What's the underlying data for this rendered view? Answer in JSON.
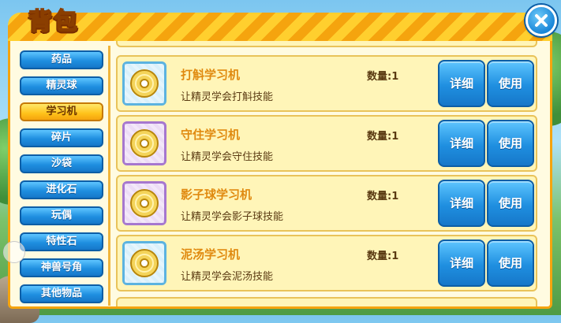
{
  "window": {
    "title": "背包",
    "close_icon": "close-icon",
    "accent_color": "#f5a40e",
    "button_color": "#1f8fe0"
  },
  "sidebar": {
    "tabs": [
      {
        "label": "药品",
        "active": false
      },
      {
        "label": "精灵球",
        "active": false
      },
      {
        "label": "学习机",
        "active": true
      },
      {
        "label": "碎片",
        "active": false
      },
      {
        "label": "沙袋",
        "active": false
      },
      {
        "label": "进化石",
        "active": false
      },
      {
        "label": "玩偶",
        "active": false
      },
      {
        "label": "特性石",
        "active": false
      },
      {
        "label": "神兽号角",
        "active": false
      },
      {
        "label": "其他物品",
        "active": false
      }
    ]
  },
  "items": [
    {
      "name": "打斛学习机",
      "desc": "让精灵学会打斛技能",
      "qty": "数量:1",
      "detail_label": "详细",
      "use_label": "使用",
      "icon": "disc-icon",
      "frame": "blue"
    },
    {
      "name": "守住学习机",
      "desc": "让精灵学会守住技能",
      "qty": "数量:1",
      "detail_label": "详细",
      "use_label": "使用",
      "icon": "disc-icon",
      "frame": "purple"
    },
    {
      "name": "影子球学习机",
      "desc": "让精灵学会影子球技能",
      "qty": "数量:1",
      "detail_label": "详细",
      "use_label": "使用",
      "icon": "disc-icon",
      "frame": "purple"
    },
    {
      "name": "泥汤学习机",
      "desc": "让精灵学会泥汤技能",
      "qty": "数量:1",
      "detail_label": "详细",
      "use_label": "使用",
      "icon": "disc-icon",
      "frame": "blue"
    }
  ]
}
